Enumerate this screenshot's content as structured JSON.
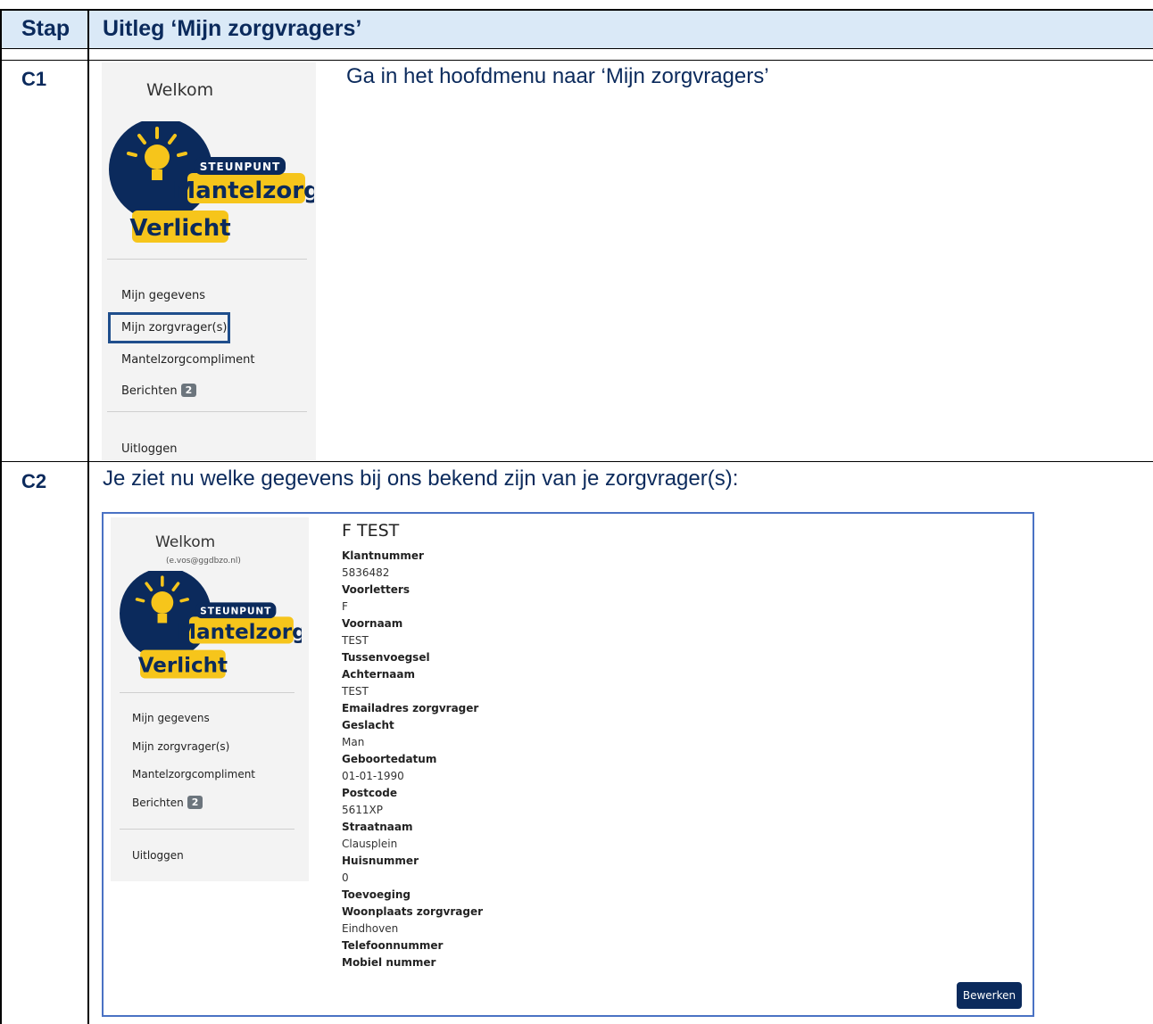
{
  "table": {
    "col_step": "Stap",
    "col_explanation": "Uitleg ‘Mijn zorgvragers’"
  },
  "rows": [
    {
      "step": "C1",
      "instruction": "Ga in het hoofdmenu naar ‘Mijn zorgvragers’"
    },
    {
      "step": "C2",
      "instruction": "Je ziet nu welke gegevens bij ons bekend zijn van je zorgvrager(s):"
    }
  ],
  "sidebar1": {
    "welcome": "Welkom",
    "logo_line1": "STEUNPUNT",
    "logo_line2": "Mantelzorg",
    "logo_line3": "Verlicht",
    "items": [
      "Mijn gegevens",
      "Mijn zorgvrager(s)",
      "Mantelzorgcompliment",
      "Berichten"
    ],
    "badge": "2",
    "logout": "Uitloggen"
  },
  "sidebar2": {
    "welcome": "Welkom",
    "email": "(e.vos@ggdbzo.nl)",
    "logo_line1": "STEUNPUNT",
    "logo_line2": "Mantelzorg",
    "logo_line3": "Verlicht",
    "items": [
      "Mijn gegevens",
      "Mijn zorgvrager(s)",
      "Mantelzorgcompliment",
      "Berichten"
    ],
    "badge": "2",
    "logout": "Uitloggen"
  },
  "record": {
    "title": "F TEST",
    "fields": [
      {
        "label": "Klantnummer",
        "value": "5836482"
      },
      {
        "label": "Voorletters",
        "value": "F"
      },
      {
        "label": "Voornaam",
        "value": "TEST"
      },
      {
        "label": "Tussenvoegsel",
        "value": ""
      },
      {
        "label": "Achternaam",
        "value": "TEST"
      },
      {
        "label": "Emailadres zorgvrager",
        "value": ""
      },
      {
        "label": "Geslacht",
        "value": "Man"
      },
      {
        "label": "Geboortedatum",
        "value": "01-01-1990"
      },
      {
        "label": "Postcode",
        "value": "5611XP"
      },
      {
        "label": "Straatnaam",
        "value": "Clausplein"
      },
      {
        "label": "Huisnummer",
        "value": "0"
      },
      {
        "label": "Toevoeging",
        "value": ""
      },
      {
        "label": "Woonplaats zorgvrager",
        "value": "Eindhoven"
      },
      {
        "label": "Telefoonnummer",
        "value": ""
      },
      {
        "label": "Mobiel nummer",
        "value": ""
      }
    ],
    "edit_button": "Bewerken"
  },
  "colors": {
    "navy": "#0b2a5c",
    "header_bg": "#dae9f7",
    "logo_yellow": "#f6c51b",
    "frame_blue": "#4a72c4"
  }
}
